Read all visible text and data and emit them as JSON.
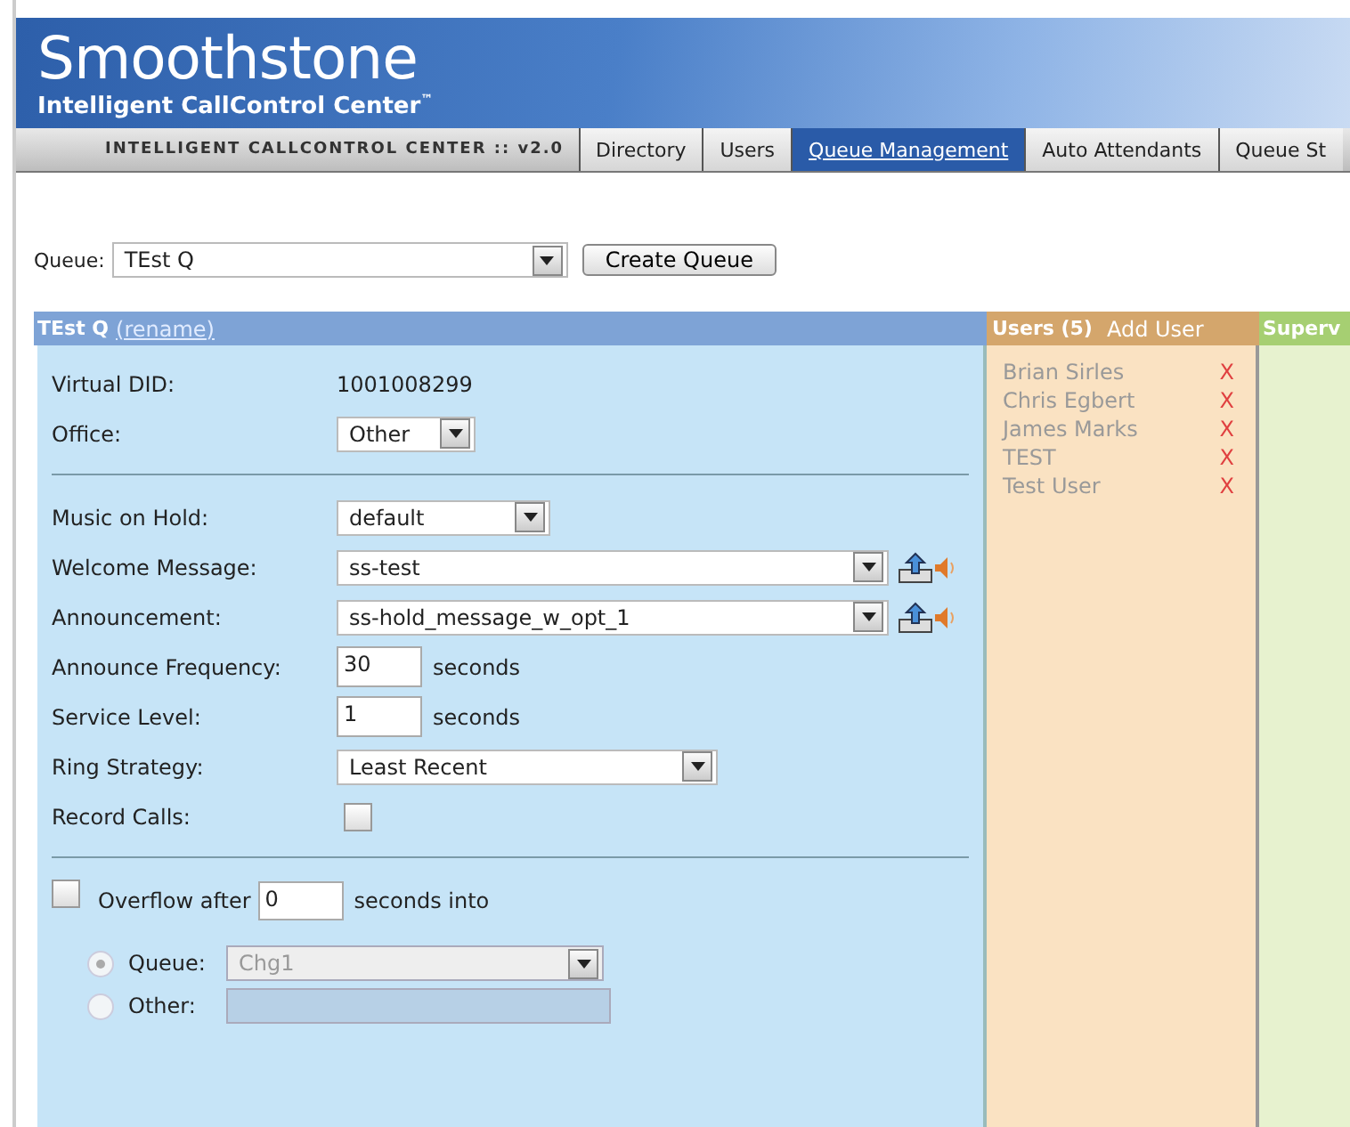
{
  "banner": {
    "title": "Smoothstone",
    "subtitle": "Intelligent CallControl Center$^{™}$"
  },
  "nav": {
    "label": "INTELLIGENT CALLCONTROL CENTER :: v2.0",
    "tabs": [
      {
        "label": "Directory",
        "selected": false
      },
      {
        "label": "Users",
        "selected": false
      },
      {
        "label": "Queue Management",
        "selected": true
      },
      {
        "label": "Auto Attendants",
        "selected": false
      },
      {
        "label": "Queue St",
        "selected": false
      }
    ]
  },
  "queue_picker": {
    "label": "Queue:",
    "value": "TEst Q",
    "button": "Create Queue"
  },
  "queue_panel": {
    "title": "TEst Q",
    "rename_link": "(rename)",
    "sections": [
      [
        {
          "kind": "text",
          "label": "Virtual DID:",
          "value": "1001008299"
        },
        {
          "kind": "short_select",
          "label": "Office:",
          "value": "Other"
        }
      ],
      [
        {
          "kind": "select",
          "label": "Music on Hold:",
          "value": "default"
        },
        {
          "kind": "media_select",
          "label": "Welcome Message:",
          "value": "ss-test"
        },
        {
          "kind": "media_select",
          "label": "Announcement:",
          "value": "ss-hold_message_w_opt_1"
        },
        {
          "kind": "number",
          "label": "Announce Frequency:",
          "value": "30",
          "unit": "seconds"
        },
        {
          "kind": "number",
          "label": "Service Level:",
          "value": "1",
          "unit": "seconds"
        },
        {
          "kind": "wide_select",
          "label": "Ring Strategy:",
          "value": "Least Recent"
        },
        {
          "kind": "checkbox",
          "label": "Record Calls:",
          "checked": false
        }
      ]
    ],
    "overflow": {
      "checked": false,
      "label": "Overflow after",
      "value": "0",
      "suffix": "seconds into",
      "options": [
        {
          "kind": "select",
          "label": "Queue:",
          "selected": true,
          "value": "Chg1",
          "disabled": true
        },
        {
          "kind": "input",
          "label": "Other:",
          "selected": false,
          "disabled": true
        }
      ]
    }
  },
  "users_panel": {
    "title": "Users (5)",
    "add_link": "Add User",
    "users": [
      {
        "name": "Brian Sirles",
        "remove": "X"
      },
      {
        "name": "Chris Egbert",
        "remove": "X"
      },
      {
        "name": "James Marks",
        "remove": "X"
      },
      {
        "name": "TEST",
        "remove": "X"
      },
      {
        "name": "Test User",
        "remove": "X"
      }
    ]
  },
  "supervisors_panel": {
    "title": "Superv"
  }
}
